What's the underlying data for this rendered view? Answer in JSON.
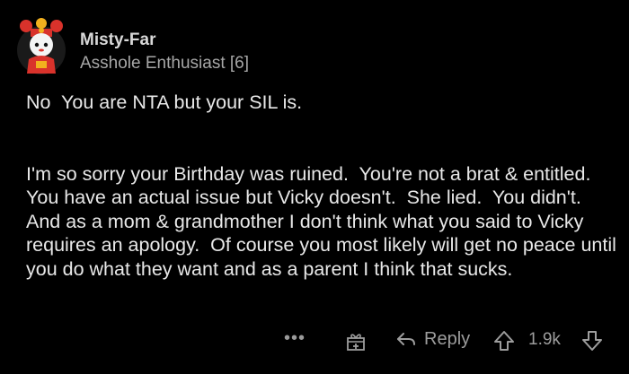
{
  "comment": {
    "author": "Misty-Far",
    "flair": "Asshole Enthusiast [6]",
    "paragraphs": [
      "No  You are NTA but your SIL is.",
      "I'm so sorry your Birthday was ruined.  You're not a brat & entitled.  You have an actual issue but Vicky doesn't.  She lied.  You didn't.  And as a mom & grandmother I don't think what you said to Vicky requires an apology.  Of course you most likely will get no peace until you do what they want and as a parent I think that sucks."
    ]
  },
  "actions": {
    "more_label": "•••",
    "award_icon": "award-gift-icon",
    "reply_label": "Reply",
    "score": "1.9k"
  },
  "colors": {
    "background": "#000000",
    "text": "#e8e8e8",
    "muted": "#9d9d9d",
    "avatar_red": "#d9322b",
    "avatar_yellow": "#f2b01e"
  }
}
